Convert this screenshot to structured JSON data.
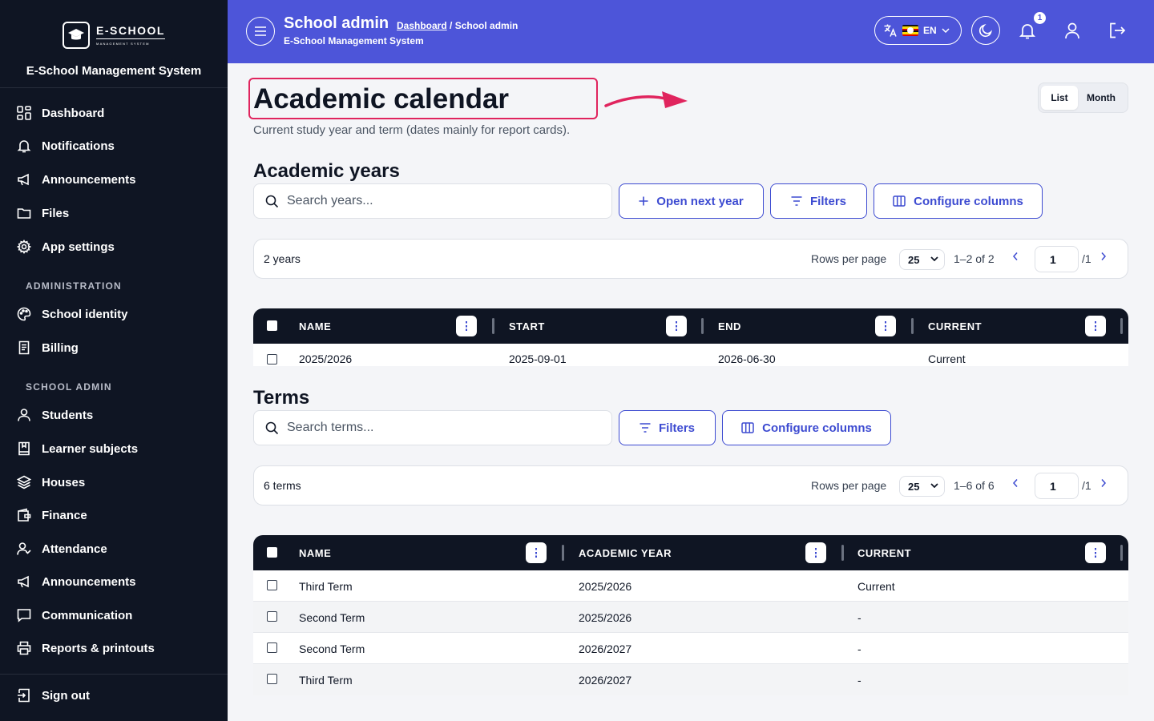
{
  "brand": {
    "logo_text": "E-SCHOOL",
    "logo_sub": "MANAGEMENT SYSTEM",
    "system_name": "E-School Management System"
  },
  "sidebar": {
    "top_items": [
      {
        "label": "Dashboard",
        "icon": "dashboard-icon"
      },
      {
        "label": "Notifications",
        "icon": "bell-icon"
      },
      {
        "label": "Announcements",
        "icon": "megaphone-icon"
      },
      {
        "label": "Files",
        "icon": "folder-icon"
      },
      {
        "label": "App settings",
        "icon": "gear-icon"
      }
    ],
    "sections": [
      {
        "title": "ADMINISTRATION",
        "items": [
          {
            "label": "School identity",
            "icon": "palette-icon"
          },
          {
            "label": "Billing",
            "icon": "receipt-icon"
          }
        ]
      },
      {
        "title": "SCHOOL ADMIN",
        "items": [
          {
            "label": "Students",
            "icon": "user-icon"
          },
          {
            "label": "Learner subjects",
            "icon": "book-icon"
          },
          {
            "label": "Houses",
            "icon": "layers-icon"
          },
          {
            "label": "Finance",
            "icon": "wallet-icon"
          },
          {
            "label": "Attendance",
            "icon": "user-check-icon"
          },
          {
            "label": "Announcements",
            "icon": "megaphone-icon"
          },
          {
            "label": "Communication",
            "icon": "message-icon"
          },
          {
            "label": "Reports & printouts",
            "icon": "printer-icon"
          }
        ]
      }
    ],
    "sign_out": "Sign out"
  },
  "header": {
    "title": "School admin",
    "breadcrumb_link": "Dashboard",
    "breadcrumb_rest": " / School admin",
    "subtitle": "E-School Management System",
    "language": "EN",
    "notification_count": "1",
    "accent_color": "#4d55d9"
  },
  "page": {
    "title": "Academic calendar",
    "subtitle": "Current study year and term (dates mainly for report cards).",
    "view_toggle": {
      "list": "List",
      "month": "Month",
      "active": "List"
    }
  },
  "years": {
    "section_title": "Academic years",
    "search_placeholder": "Search years...",
    "open_next_label": "Open next year",
    "filters_label": "Filters",
    "configure_label": "Configure columns",
    "count_label": "2 years",
    "rows_per_page_label": "Rows per page",
    "rows_per_page": "25",
    "range": "1–2 of 2",
    "page": "1",
    "total_pages": "/1",
    "columns": [
      "NAME",
      "START",
      "END",
      "CURRENT"
    ],
    "rows": [
      [
        "2025/2026",
        "2025-09-01",
        "2026-06-30",
        "Current"
      ]
    ]
  },
  "terms": {
    "section_title": "Terms",
    "search_placeholder": "Search terms...",
    "filters_label": "Filters",
    "configure_label": "Configure columns",
    "count_label": "6 terms",
    "rows_per_page_label": "Rows per page",
    "rows_per_page": "25",
    "range": "1–6 of 6",
    "page": "1",
    "total_pages": "/1",
    "columns": [
      "NAME",
      "ACADEMIC YEAR",
      "CURRENT"
    ],
    "rows": [
      [
        "Third Term",
        "2025/2026",
        "Current"
      ],
      [
        "Second Term",
        "2025/2026",
        "-"
      ],
      [
        "Second Term",
        "2026/2027",
        "-"
      ],
      [
        "Third Term",
        "2026/2027",
        "-"
      ]
    ]
  }
}
